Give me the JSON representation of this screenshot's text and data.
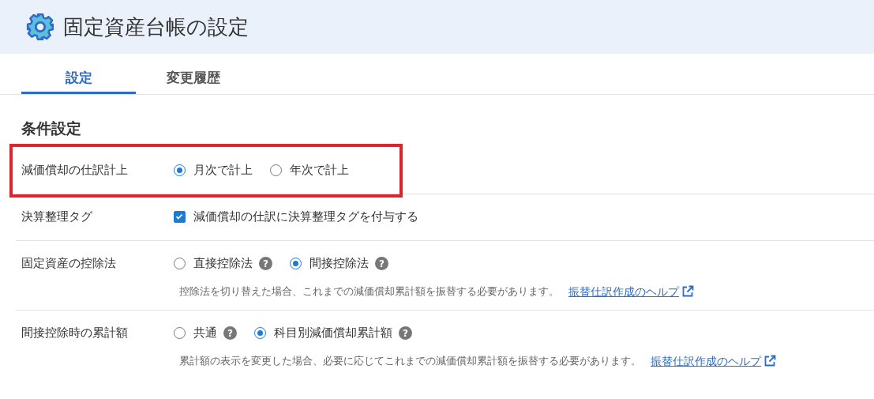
{
  "header": {
    "title": "固定資産台帳の設定"
  },
  "tabs": [
    {
      "label": "設定",
      "selected": true
    },
    {
      "label": "変更履歴",
      "selected": false
    }
  ],
  "section": {
    "title": "条件設定"
  },
  "rows": [
    {
      "label": "減価償却の仕訳計上",
      "kind": "radio",
      "highlighted": true,
      "options": [
        {
          "label": "月次で計上",
          "selected": true
        },
        {
          "label": "年次で計上",
          "selected": false
        }
      ]
    },
    {
      "label": "決算整理タグ",
      "kind": "checkbox",
      "highlighted": false,
      "options": [
        {
          "label": "減価償却の仕訳に決算整理タグを付与する",
          "checked": true
        }
      ]
    },
    {
      "label": "固定資産の控除法",
      "kind": "radio",
      "highlighted": false,
      "options": [
        {
          "label": "直接控除法",
          "selected": false,
          "help": "?"
        },
        {
          "label": "間接控除法",
          "selected": true,
          "help": "?"
        }
      ],
      "note": "控除法を切り替えた場合、これまでの減価償却累計額を振替する必要があります。",
      "link": "振替仕訳作成のヘルプ"
    },
    {
      "label": "間接控除時の累計額",
      "kind": "radio",
      "highlighted": false,
      "options": [
        {
          "label": "共通",
          "selected": false,
          "help": "?"
        },
        {
          "label": "科目別減価償却累計額",
          "selected": true,
          "help": "?"
        }
      ],
      "note": "累計額の表示を変更した場合、必要に応じてこれまでの減価償却累計額を振替する必要があります。",
      "link": "振替仕訳作成のヘルプ"
    }
  ]
}
